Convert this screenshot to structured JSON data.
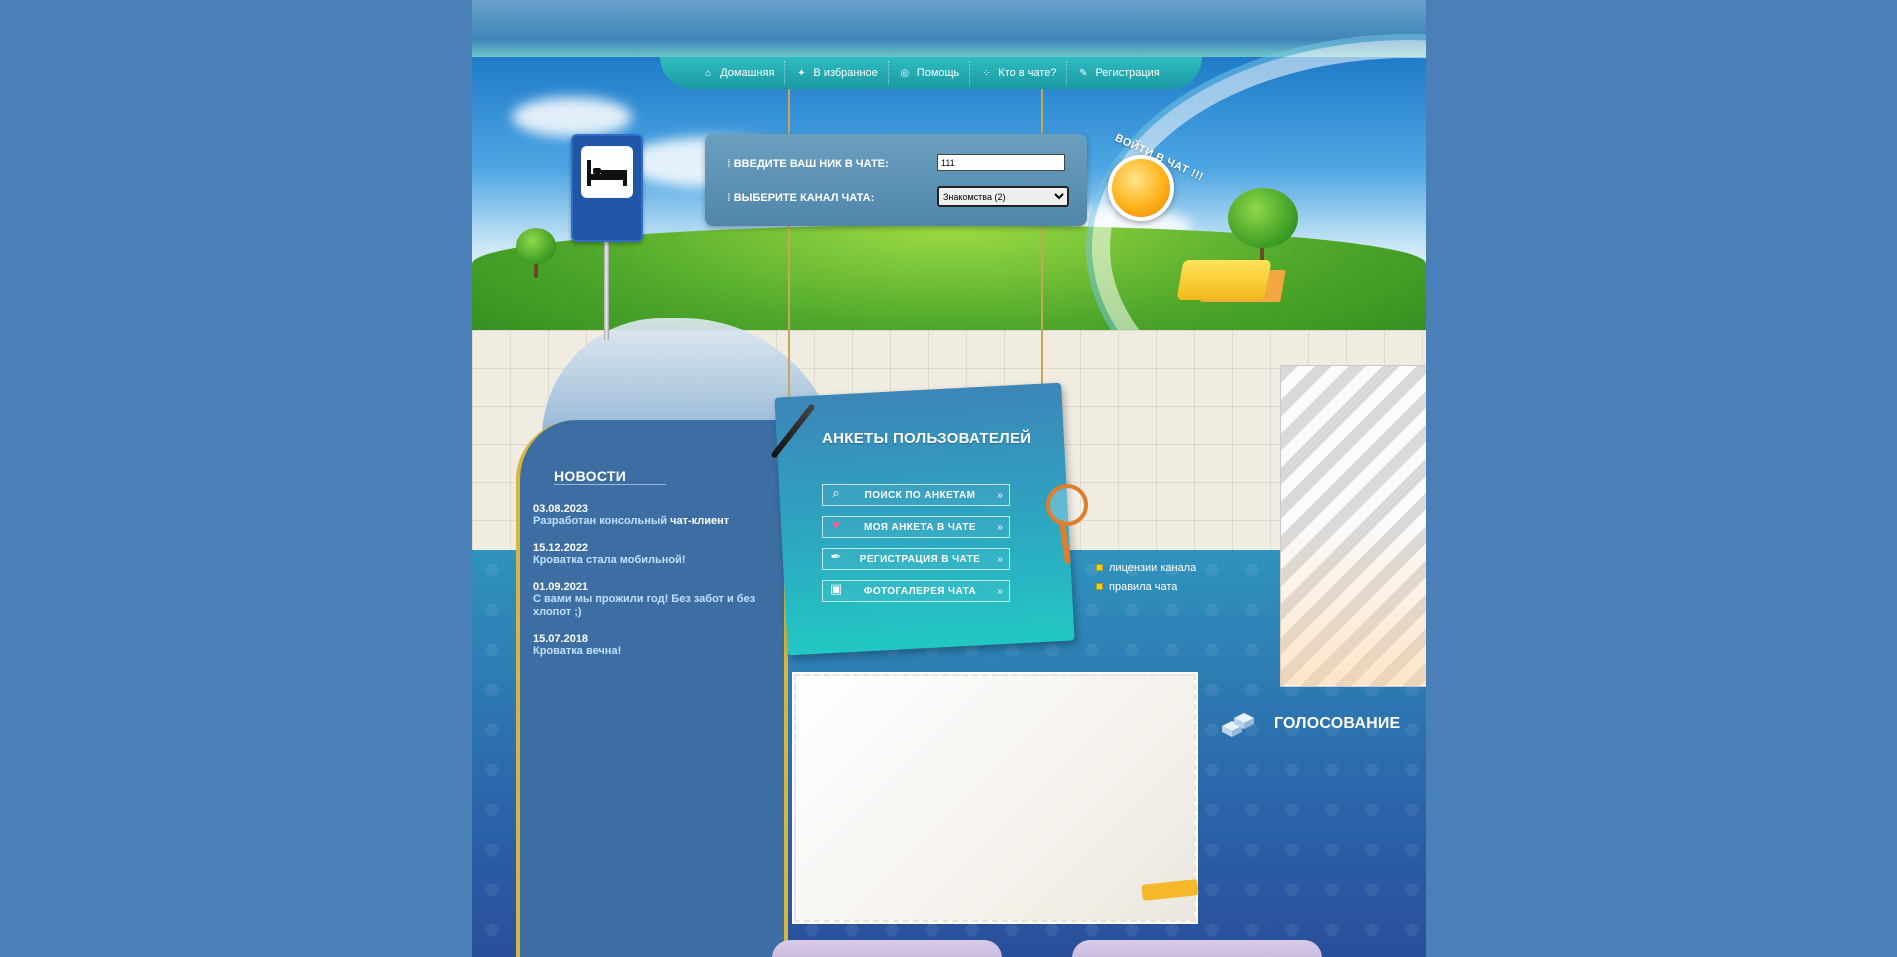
{
  "nav": {
    "items": [
      {
        "label": "Домашняя",
        "icon": "home-icon"
      },
      {
        "label": "В избранное",
        "icon": "sparkle-star-icon"
      },
      {
        "label": "Помощь",
        "icon": "lifebuoy-icon"
      },
      {
        "label": "Кто в чате?",
        "icon": "users-dots-icon"
      },
      {
        "label": "Регистрация",
        "icon": "pencil-icon"
      }
    ]
  },
  "login": {
    "nick_label": "ВВЕДИТЕ ВАШ НИК В ЧАТЕ:",
    "nick_value": "111",
    "channel_label": "ВЫБЕРИТЕ КАНАЛ ЧАТА:",
    "channel_selected": "Знакомства (2)",
    "enter_label": "ВОЙТИ В ЧАТ !!!"
  },
  "news": {
    "title": "НОВОСТИ",
    "items": [
      {
        "date": "03.08.2023",
        "text": "Разработан консольный ",
        "highlight": "чат-клиент"
      },
      {
        "date": "15.12.2022",
        "text": "Кроватка стала мобильной!",
        "highlight": ""
      },
      {
        "date": "01.09.2021",
        "text": "С вами мы прожили год! Без забот и без хлопот ;)",
        "highlight": ""
      },
      {
        "date": "15.07.2018",
        "text": "Кроватка вечна!",
        "highlight": ""
      }
    ]
  },
  "profiles": {
    "title": "АНКЕТЫ ПОЛЬЗОВАТЕЛЕЙ",
    "menu": [
      {
        "label": "ПОИСК ПО АНКЕТАМ",
        "icon": "magnifier-icon"
      },
      {
        "label": "МОЯ АНКЕТА В ЧАТЕ",
        "icon": "heart-icon"
      },
      {
        "label": "РЕГИСТРАЦИЯ В ЧАТЕ",
        "icon": "pen-icon"
      },
      {
        "label": "ФОТОГАЛЕРЕЯ ЧАТА",
        "icon": "photo-icon"
      }
    ],
    "arrow": "»"
  },
  "side_links": [
    {
      "label": "лицензии канала"
    },
    {
      "label": "правила чата"
    }
  ],
  "vote": {
    "title": "ГОЛОСОВАНИЕ"
  },
  "colors": {
    "page_bg": "#4a7fb7",
    "nav_bg": "#1fa9b0",
    "accent_gold": "#d8b53c",
    "enter_orange": "#ffb21a"
  }
}
